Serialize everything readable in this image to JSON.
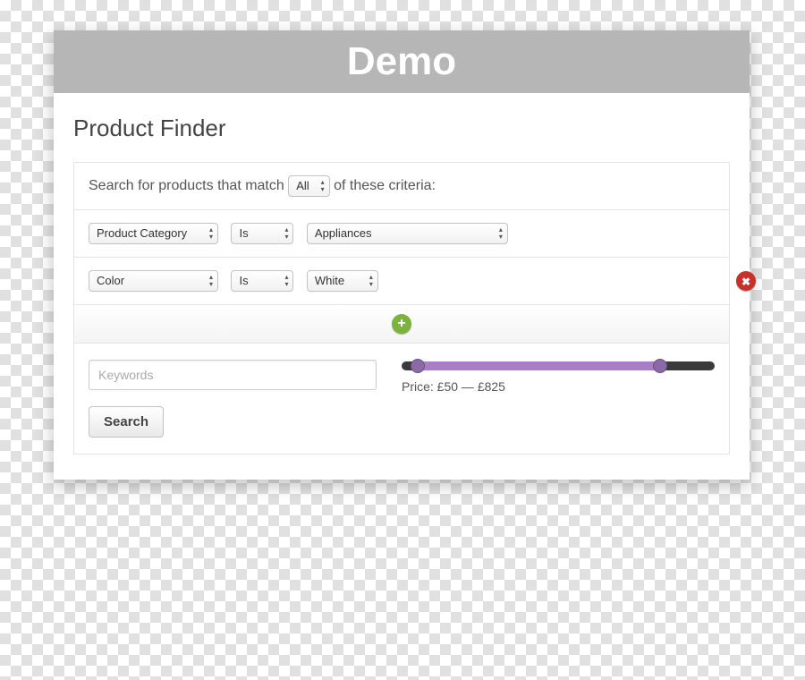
{
  "window": {
    "title": "Demo"
  },
  "page": {
    "title": "Product Finder"
  },
  "criteria": {
    "prefix": "Search for products that match",
    "match_mode": "All",
    "suffix": "of these criteria:"
  },
  "rules": [
    {
      "field": "Product Category",
      "op": "Is",
      "value": "Appliances",
      "removable": false
    },
    {
      "field": "Color",
      "op": "Is",
      "value": "White",
      "removable": true
    }
  ],
  "keywords": {
    "placeholder": "Keywords",
    "value": ""
  },
  "price": {
    "label_prefix": "Price:",
    "currency": "£",
    "min": 50,
    "max": 825,
    "range_min": 0,
    "range_max": 1000,
    "display": "Price: £50 — £825"
  },
  "buttons": {
    "search": "Search"
  },
  "select_widths": {
    "field": "145px",
    "op": "70px",
    "value_wide": "225px",
    "value_narrow": "80px",
    "match": "54px"
  }
}
